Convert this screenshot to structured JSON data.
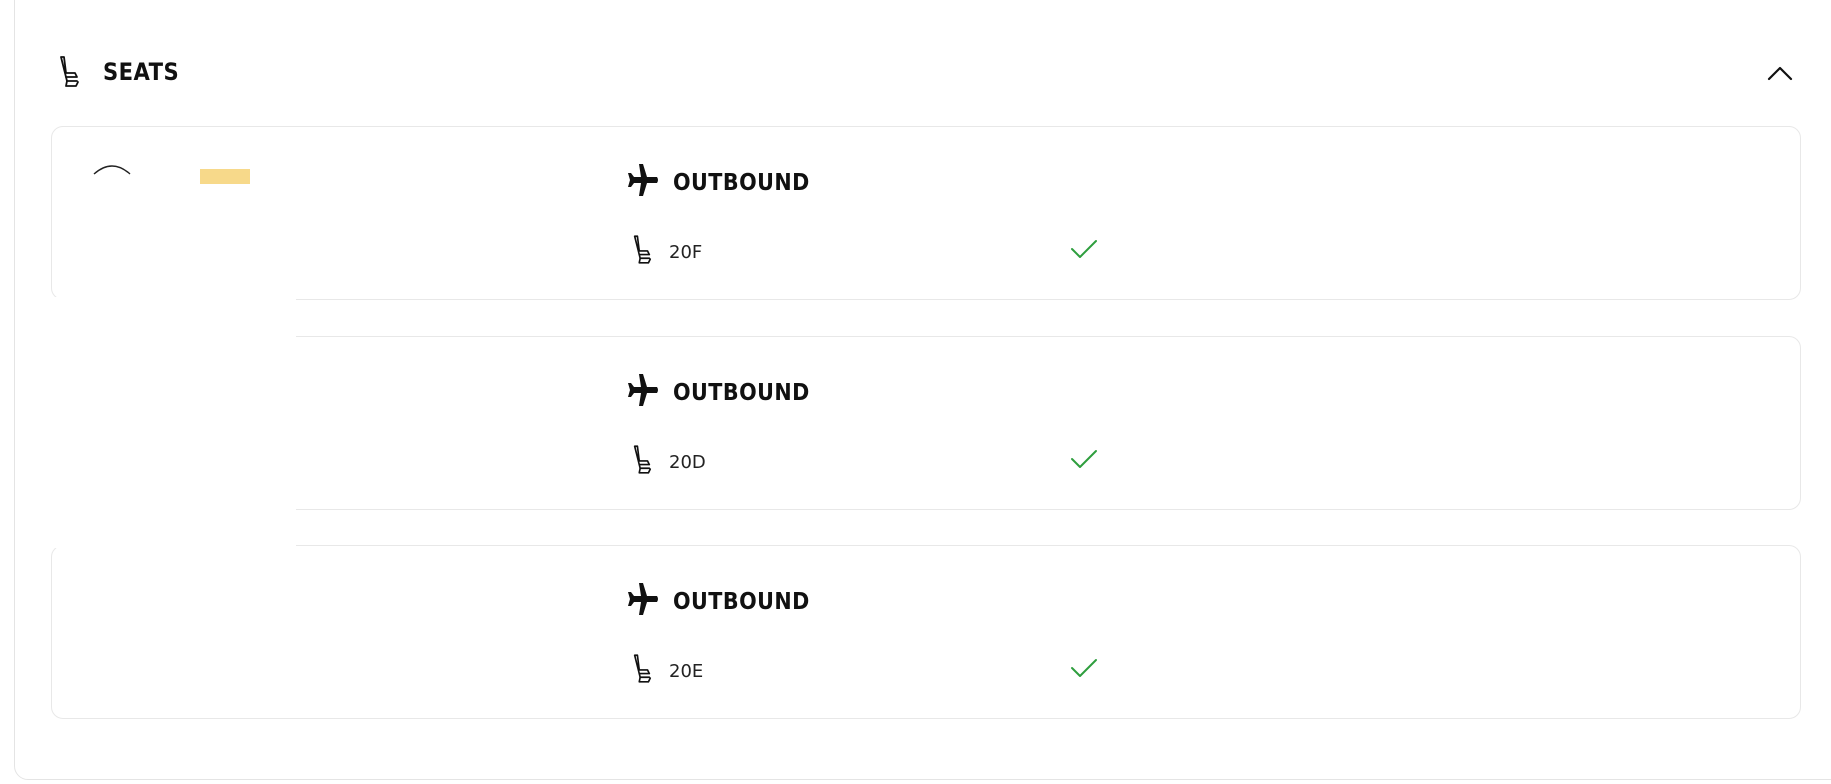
{
  "section": {
    "title": "SEATS",
    "icon": "seat-icon",
    "collapse_icon": "chevron-up-icon"
  },
  "loader": {
    "bar_color": "#f7d98a"
  },
  "cards": [
    {
      "direction": "OUTBOUND",
      "seat": "20F",
      "status_icon": "check-icon"
    },
    {
      "direction": "OUTBOUND",
      "seat": "20D",
      "status_icon": "check-icon"
    },
    {
      "direction": "OUTBOUND",
      "seat": "20E",
      "status_icon": "check-icon"
    }
  ],
  "colors": {
    "check": "#2e9e3e",
    "border": "#e6e6e6",
    "text": "#111111"
  }
}
